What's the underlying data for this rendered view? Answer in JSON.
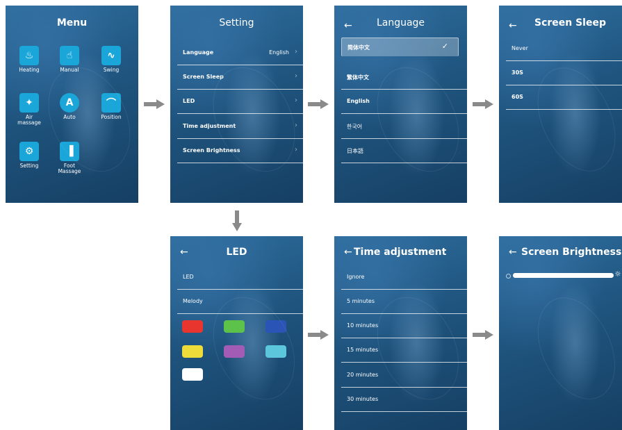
{
  "menu": {
    "title": "Menu",
    "items": [
      {
        "label": "Heating",
        "icon": "heating-icon",
        "glyph": "♨"
      },
      {
        "label": "Manual",
        "icon": "hand-icon",
        "glyph": "☝"
      },
      {
        "label": "Swing",
        "icon": "swing-icon",
        "glyph": "∿"
      },
      {
        "label": "Air\nmassage",
        "icon": "air-massage-icon",
        "glyph": "✦"
      },
      {
        "label": "Auto",
        "icon": "auto-icon",
        "glyph": "A"
      },
      {
        "label": "Position",
        "icon": "position-icon",
        "glyph": "⌒"
      },
      {
        "label": "Setting",
        "icon": "gear-icon",
        "glyph": "⚙"
      },
      {
        "label": "Foot\nMassage",
        "icon": "foot-icon",
        "glyph": "▐"
      }
    ]
  },
  "setting": {
    "title": "Setting",
    "rows": [
      {
        "label": "Language",
        "value": "English"
      },
      {
        "label": "Screen Sleep",
        "value": ""
      },
      {
        "label": "LED",
        "value": ""
      },
      {
        "label": "Time adjustment",
        "value": ""
      },
      {
        "label": "Screen Brightness",
        "value": ""
      }
    ]
  },
  "language": {
    "title": "Language",
    "back": "←",
    "check": "✓",
    "options": [
      "简体中文",
      "繁体中文",
      "English",
      "한국어",
      "日本語"
    ]
  },
  "sleep": {
    "title": "Screen Sleep",
    "back": "←",
    "options": [
      "Never",
      "30S",
      "60S"
    ]
  },
  "led": {
    "title": "LED",
    "back": "←",
    "rows": [
      "LED",
      "Melody"
    ],
    "colors": [
      "#e8362f",
      "#5cc24a",
      "#2a54b5",
      "#eedc3a",
      "#a25cb6",
      "#5cc6dc",
      "#ffffff"
    ]
  },
  "time": {
    "title": "Time adjustment",
    "back": "←",
    "options": [
      "Ignore",
      "5 minutes",
      "10 minutes",
      "15 minutes",
      "20 minutes",
      "30 minutes"
    ]
  },
  "brightness": {
    "title": "Screen Brightness",
    "back": "←",
    "level": 1.0,
    "sun_glyph": "☼"
  },
  "colors": {
    "arrow": "#8a8a8a",
    "menu_icon": "#1aa6d9"
  }
}
